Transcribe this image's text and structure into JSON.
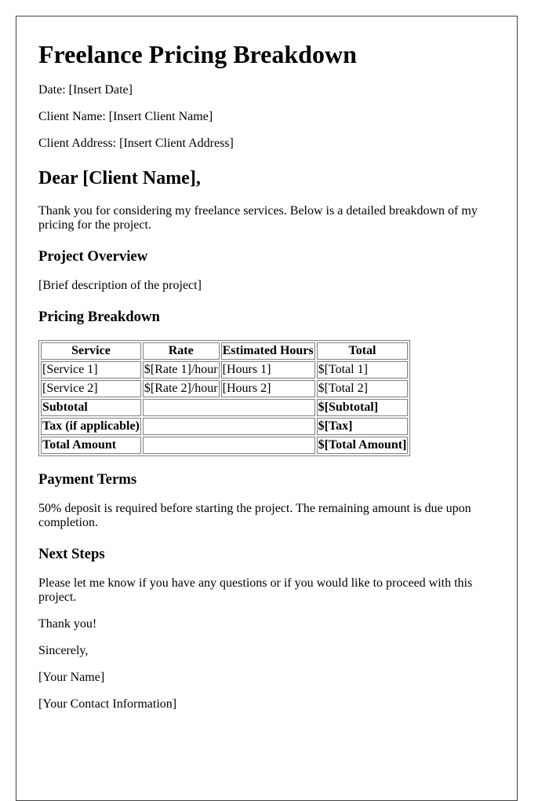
{
  "title": "Freelance Pricing Breakdown",
  "meta": {
    "date": "Date: [Insert Date]",
    "client_name": "Client Name: [Insert Client Name]",
    "client_address": "Client Address: [Insert Client Address]"
  },
  "greeting": "Dear [Client Name],",
  "intro": "Thank you for considering my freelance services. Below is a detailed breakdown of my pricing for the project.",
  "project_overview": {
    "heading": "Project Overview",
    "text": "[Brief description of the project]"
  },
  "pricing": {
    "heading": "Pricing Breakdown",
    "columns": [
      "Service",
      "Rate",
      "Estimated Hours",
      "Total"
    ],
    "rows": [
      [
        "[Service 1]",
        "$[Rate 1]/hour",
        "[Hours 1]",
        "$[Total 1]"
      ],
      [
        "[Service 2]",
        "$[Rate 2]/hour",
        "[Hours 2]",
        "$[Total 2]"
      ]
    ],
    "summary": [
      {
        "label": "Subtotal",
        "value": "$[Subtotal]"
      },
      {
        "label": "Tax (if applicable)",
        "value": "$[Tax]"
      },
      {
        "label": "Total Amount",
        "value": "$[Total Amount]"
      }
    ]
  },
  "payment_terms": {
    "heading": "Payment Terms",
    "text": "50% deposit is required before starting the project. The remaining amount is due upon completion."
  },
  "next_steps": {
    "heading": "Next Steps",
    "text": "Please let me know if you have any questions or if you would like to proceed with this project."
  },
  "closing": {
    "thanks": "Thank you!",
    "signoff": "Sincerely,",
    "name": "[Your Name]",
    "contact": "[Your Contact Information]"
  }
}
